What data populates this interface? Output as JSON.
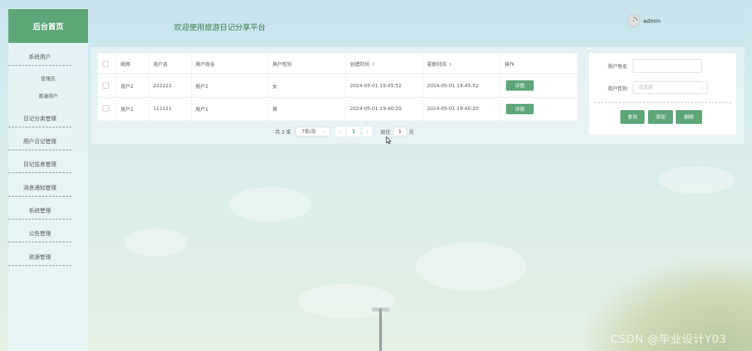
{
  "brand": {
    "title": "后台首页"
  },
  "header": {
    "welcome": "欢迎使用旅游日记分享平台",
    "username": "admin"
  },
  "sidebar": {
    "items": [
      {
        "label": "系统用户",
        "children": [
          "管理员",
          "普通用户"
        ]
      },
      {
        "label": "日记分类管理"
      },
      {
        "label": "用户日记管理"
      },
      {
        "label": "日记信息管理"
      },
      {
        "label": "消息通知管理"
      },
      {
        "label": "系统管理"
      },
      {
        "label": "公告管理"
      },
      {
        "label": "资源管理"
      }
    ]
  },
  "table": {
    "columns": [
      "昵称",
      "用户名",
      "用户姓名",
      "用户性别",
      "创建时间",
      "更新时间",
      "操作"
    ],
    "sortable_marker": "⇕",
    "rows": [
      {
        "nickname": "用户2",
        "username": "222222",
        "realname": "用户2",
        "gender": "女",
        "created": "2024-05-01 19:45:52",
        "updated": "2024-05-01 19:45:52",
        "action": "详情"
      },
      {
        "nickname": "用户1",
        "username": "111111",
        "realname": "用户1",
        "gender": "男",
        "created": "2024-05-01 19:40:20",
        "updated": "2024-05-01 19:40:20",
        "action": "详情"
      }
    ]
  },
  "pagination": {
    "total": "共 2 条",
    "page_size": "7条/页",
    "current_page": "1",
    "jump_label": "前往",
    "jump_value": "1",
    "page_suffix": "页",
    "prev": "‹",
    "next": "›"
  },
  "search": {
    "name_label": "用户姓名",
    "name_value": "",
    "gender_label": "用户性别",
    "gender_placeholder": "请选择",
    "query_button": "查询",
    "add_button": "添加",
    "delete_button": "删除"
  },
  "watermark": "CSDN @毕业设计Y03",
  "colors": {
    "accent": "#5ea678",
    "welcome_text": "#3d7a4e"
  }
}
